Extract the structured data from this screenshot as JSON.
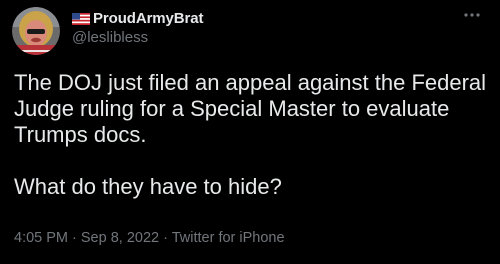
{
  "author": {
    "display_name": "ProudArmyBrat",
    "handle": "@leslibless",
    "flag_icon": "us-flag-icon",
    "avatar_icon": "profile-photo"
  },
  "tweet": {
    "paragraph_1": "The DOJ just filed an appeal against the Federal Judge ruling for a Special Master to evaluate Trumps docs.",
    "paragraph_2": "What do they have to hide?"
  },
  "meta": {
    "time": "4:05 PM",
    "separator": " · ",
    "date": "Sep 8, 2022",
    "source": "Twitter for iPhone"
  },
  "colors": {
    "background": "#000000",
    "text": "#e7e9ea",
    "secondary_text": "#71767b"
  },
  "more_icon": "more-horizontal-icon"
}
